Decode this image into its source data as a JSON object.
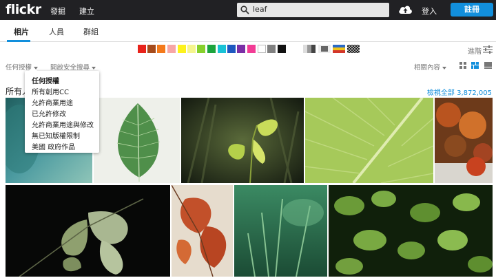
{
  "header": {
    "logo": "flickr",
    "nav": [
      "發掘",
      "建立"
    ],
    "search_value": "leaf",
    "login": "登入",
    "signup": "註冊"
  },
  "tabs": [
    "相片",
    "人員",
    "群組"
  ],
  "colors": [
    "#e8231b",
    "#a64b1c",
    "#f47a1b",
    "#f7a6a6",
    "#fdf21c",
    "#f5f58d",
    "#87d02c",
    "#1da43d",
    "#19c2d6",
    "#1e58c0",
    "#7b2fa6",
    "#f23c95",
    "#ffffff",
    "#808080",
    "#111111"
  ],
  "advanced_label": "進階",
  "filters": {
    "license": "任何授權",
    "safe_search": "開啟安全搜尋",
    "sort": "相關內容"
  },
  "heading": "所有人",
  "view_all": "檢視全部 3,872,005",
  "license_menu": [
    "任何授權",
    "所有創用CC",
    "允許商業用途",
    "已允許修改",
    "允許商業用途與修改",
    "無已知版權限制",
    "美國 政府作品"
  ],
  "icons": {
    "search": "search-icon",
    "upload": "cloud-upload-icon",
    "advanced": "sliders-icon",
    "grid_small": "grid-small-icon",
    "grid_justified": "grid-justified-icon",
    "grid_large": "grid-large-icon"
  }
}
